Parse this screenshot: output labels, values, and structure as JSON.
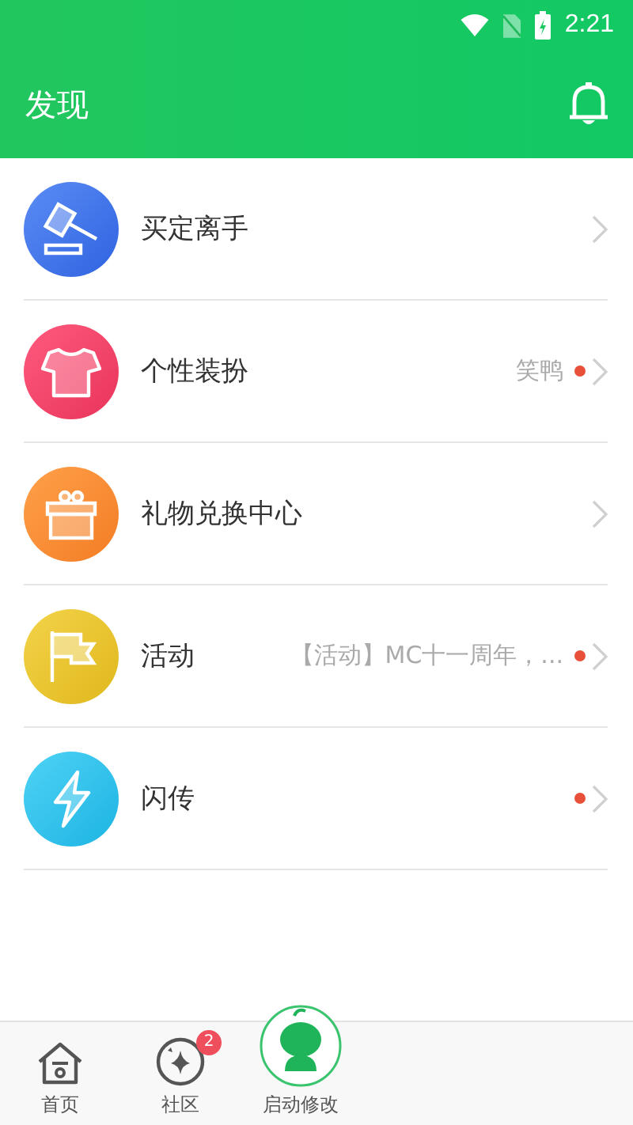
{
  "status_bar": {
    "time": "2:21"
  },
  "app_bar": {
    "title": "发现"
  },
  "items": [
    {
      "kind": "gavel",
      "label": "买定离手",
      "dot": false
    },
    {
      "kind": "shirt",
      "label": "个性装扮",
      "detail": "笑鸭",
      "dot": true
    },
    {
      "kind": "gift",
      "label": "礼物兑换中心",
      "dot": false
    },
    {
      "kind": "flag",
      "label": "活动",
      "detail": "【活动】MC十一周年，...",
      "dot": true
    },
    {
      "kind": "bolt",
      "label": "闪传",
      "dot": true
    }
  ],
  "tabs": [
    {
      "kind": "home",
      "label": "首页",
      "selected": false
    },
    {
      "kind": "community",
      "label": "社区",
      "badge": "2",
      "selected": false
    },
    {
      "kind": "launcher",
      "label": "启动修改",
      "selected": false
    }
  ]
}
